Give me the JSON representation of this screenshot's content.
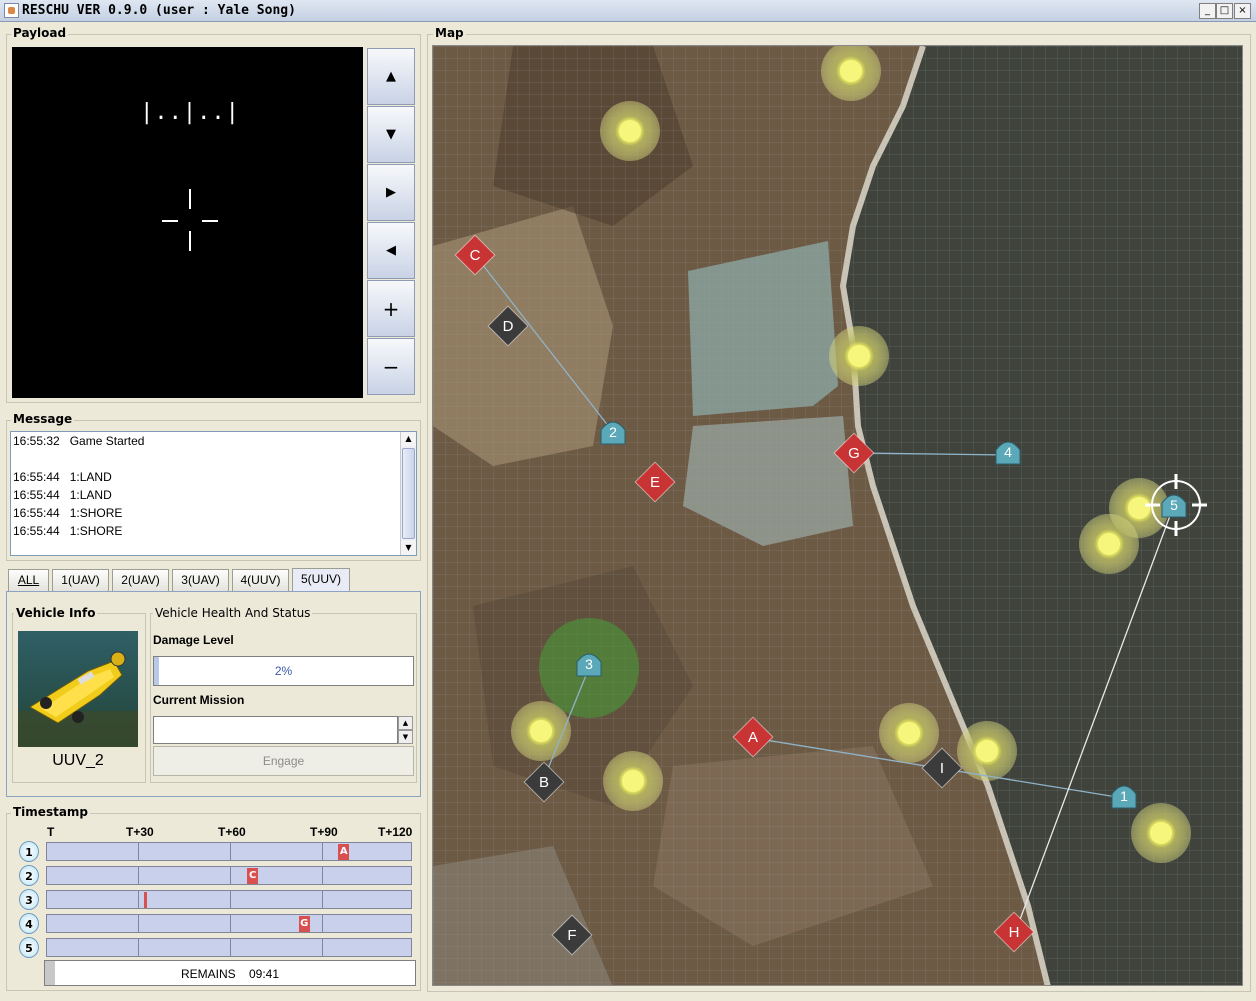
{
  "window": {
    "title": "RESCHU VER 0.9.0 (user : Yale Song)",
    "minimize": "_",
    "maximize": "□",
    "close": "×"
  },
  "payload": {
    "title": "Payload",
    "hud_text": "|..|..|",
    "buttons": [
      "▲",
      "▼",
      "▶",
      "◀",
      "+",
      "−"
    ]
  },
  "message": {
    "title": "Message",
    "lines": [
      "16:55:32   Game Started",
      "",
      "16:55:44   1:LAND",
      "16:55:44   1:LAND",
      "16:55:44   1:SHORE",
      "16:55:44   1:SHORE"
    ]
  },
  "tabs": {
    "items": [
      "ALL",
      "1(UAV)",
      "2(UAV)",
      "3(UAV)",
      "4(UUV)",
      "5(UUV)"
    ],
    "active": "5(UUV)"
  },
  "vehicle": {
    "info_title": "Vehicle Info",
    "name": "UUV_2",
    "health_title": "Vehicle Health And Status",
    "damage_label": "Damage Level",
    "damage_value": "2%",
    "damage_fraction": 0.02,
    "mission_label": "Current Mission",
    "mission_value": "",
    "engage_label": "Engage"
  },
  "timestamp": {
    "title": "Timestamp",
    "ticks": [
      "T",
      "T+30",
      "T+60",
      "T+90",
      "T+120"
    ],
    "rows": [
      "1",
      "2",
      "3",
      "4",
      "5"
    ],
    "events": [
      {
        "row": 1,
        "label": "A",
        "t": 96
      },
      {
        "row": 2,
        "label": "C",
        "t": 66
      },
      {
        "row": 3,
        "label": "",
        "t": 32
      },
      {
        "row": 4,
        "label": "G",
        "t": 83
      }
    ],
    "remains_label": "REMAINS",
    "remains_time": "09:41"
  },
  "map": {
    "title": "Map",
    "targets_red": [
      {
        "label": "C"
      },
      {
        "label": "G"
      },
      {
        "label": "E"
      },
      {
        "label": "A"
      },
      {
        "label": "H"
      }
    ],
    "targets_gray": [
      {
        "label": "D"
      },
      {
        "label": "B"
      },
      {
        "label": "I"
      },
      {
        "label": "F"
      }
    ],
    "vehicles": [
      "1",
      "2",
      "3",
      "4",
      "5"
    ],
    "colors": {
      "target_red": "#c83434",
      "target_gray": "#3b3b3b",
      "vehicle": "#5aa8b8",
      "hazard": "#eeee66",
      "land": "#6b5a45",
      "water": "#3a3e38"
    }
  }
}
